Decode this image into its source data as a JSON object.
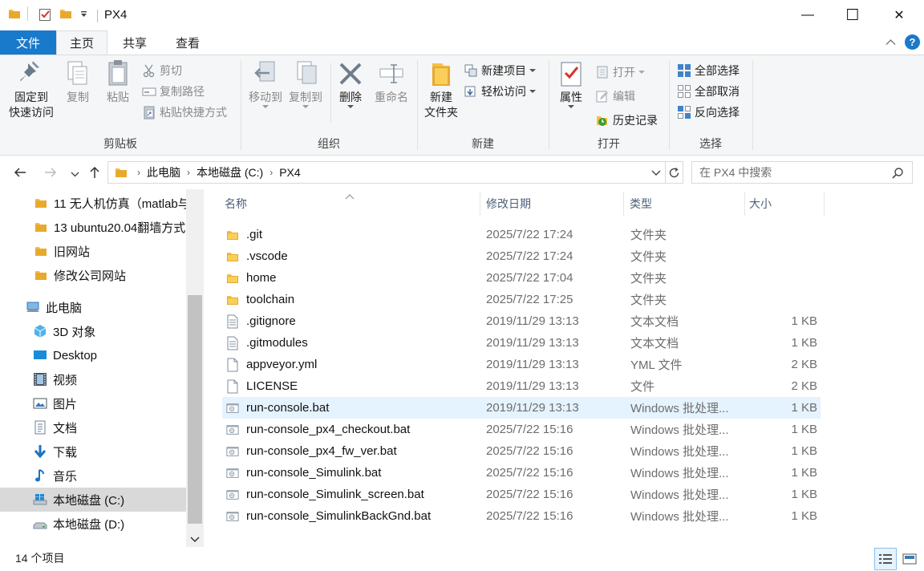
{
  "window": {
    "title": "PX4",
    "minimize": "—",
    "maximize": "☐",
    "close": "✕"
  },
  "tabs": {
    "file": "文件",
    "home": "主页",
    "share": "共享",
    "view": "查看"
  },
  "ribbon": {
    "clipboard": {
      "label": "剪贴板",
      "pin_line1": "固定到",
      "pin_line2": "快速访问",
      "copy": "复制",
      "paste": "粘贴",
      "cut": "剪切",
      "copy_path": "复制路径",
      "paste_shortcut": "粘贴快捷方式"
    },
    "organize": {
      "label": "组织",
      "move_to": "移动到",
      "copy_to": "复制到",
      "delete": "删除",
      "rename": "重命名"
    },
    "new": {
      "label": "新建",
      "new_folder_line1": "新建",
      "new_folder_line2": "文件夹",
      "new_item": "新建项目",
      "easy_access": "轻松访问"
    },
    "open": {
      "label": "打开",
      "properties": "属性",
      "open": "打开",
      "edit": "编辑",
      "history": "历史记录"
    },
    "select": {
      "label": "选择",
      "select_all": "全部选择",
      "select_none": "全部取消",
      "invert": "反向选择"
    }
  },
  "address": {
    "crumbs": [
      "此电脑",
      "本地磁盘 (C:)",
      "PX4"
    ],
    "search_placeholder": "在 PX4 中搜索"
  },
  "nav_pane": {
    "items": [
      {
        "label": "11 无人机仿真（matlab与",
        "icon": "folder-icon"
      },
      {
        "label": "13 ubuntu20.04翻墙方式",
        "icon": "folder-icon"
      },
      {
        "label": "旧网站",
        "icon": "folder-icon"
      },
      {
        "label": "修改公司网站",
        "icon": "folder-icon"
      },
      {
        "label": "此电脑",
        "icon": "computer-icon"
      },
      {
        "label": "3D 对象",
        "icon": "cube-icon"
      },
      {
        "label": "Desktop",
        "icon": "desktop-icon"
      },
      {
        "label": "视频",
        "icon": "video-icon"
      },
      {
        "label": "图片",
        "icon": "picture-icon"
      },
      {
        "label": "文档",
        "icon": "document-icon"
      },
      {
        "label": "下载",
        "icon": "download-icon"
      },
      {
        "label": "音乐",
        "icon": "music-icon"
      },
      {
        "label": "本地磁盘 (C:)",
        "icon": "windows-drive-icon"
      },
      {
        "label": "本地磁盘 (D:)",
        "icon": "drive-icon"
      }
    ]
  },
  "columns": {
    "name": "名称",
    "date": "修改日期",
    "type": "类型",
    "size": "大小"
  },
  "files": [
    {
      "name": ".git",
      "date": "2025/7/22 17:24",
      "type": "文件夹",
      "size": "",
      "icon": "folder-icon"
    },
    {
      "name": ".vscode",
      "date": "2025/7/22 17:24",
      "type": "文件夹",
      "size": "",
      "icon": "folder-icon"
    },
    {
      "name": "home",
      "date": "2025/7/22 17:04",
      "type": "文件夹",
      "size": "",
      "icon": "folder-icon"
    },
    {
      "name": "toolchain",
      "date": "2025/7/22 17:25",
      "type": "文件夹",
      "size": "",
      "icon": "folder-icon"
    },
    {
      "name": ".gitignore",
      "date": "2019/11/29 13:13",
      "type": "文本文档",
      "size": "1 KB",
      "icon": "text-file-icon"
    },
    {
      "name": ".gitmodules",
      "date": "2019/11/29 13:13",
      "type": "文本文档",
      "size": "1 KB",
      "icon": "text-file-icon"
    },
    {
      "name": "appveyor.yml",
      "date": "2019/11/29 13:13",
      "type": "YML 文件",
      "size": "2 KB",
      "icon": "blank-file-icon"
    },
    {
      "name": "LICENSE",
      "date": "2019/11/29 13:13",
      "type": "文件",
      "size": "2 KB",
      "icon": "blank-file-icon"
    },
    {
      "name": "run-console.bat",
      "date": "2019/11/29 13:13",
      "type": "Windows 批处理...",
      "size": "1 KB",
      "icon": "batch-file-icon"
    },
    {
      "name": "run-console_px4_checkout.bat",
      "date": "2025/7/22 15:16",
      "type": "Windows 批处理...",
      "size": "1 KB",
      "icon": "batch-file-icon"
    },
    {
      "name": "run-console_px4_fw_ver.bat",
      "date": "2025/7/22 15:16",
      "type": "Windows 批处理...",
      "size": "1 KB",
      "icon": "batch-file-icon"
    },
    {
      "name": "run-console_Simulink.bat",
      "date": "2025/7/22 15:16",
      "type": "Windows 批处理...",
      "size": "1 KB",
      "icon": "batch-file-icon"
    },
    {
      "name": "run-console_Simulink_screen.bat",
      "date": "2025/7/22 15:16",
      "type": "Windows 批处理...",
      "size": "1 KB",
      "icon": "batch-file-icon"
    },
    {
      "name": "run-console_SimulinkBackGnd.bat",
      "date": "2025/7/22 15:16",
      "type": "Windows 批处理...",
      "size": "1 KB",
      "icon": "batch-file-icon"
    }
  ],
  "status": {
    "count": "14 个项目"
  },
  "colors": {
    "accent": "#1979ca",
    "folder": "#f6c143",
    "hover_row": "#e5f3ff",
    "selected_nav": "#d9d9d9"
  }
}
